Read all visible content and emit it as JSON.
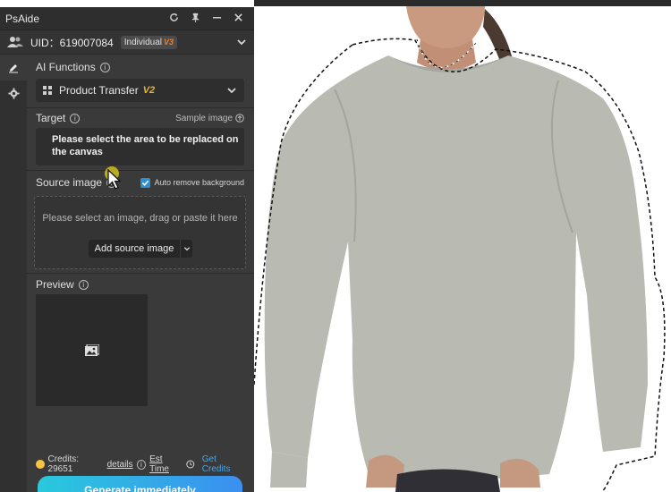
{
  "window": {
    "title": "PsAide",
    "controls": [
      "refresh-icon",
      "pin-icon",
      "minimize-icon",
      "close-icon"
    ]
  },
  "user": {
    "uid_label": "UID：619007084",
    "plan_label": "Individual",
    "plan_version": "V3"
  },
  "ai_functions": {
    "label": "AI Functions",
    "selected": "Product Transfer",
    "selected_version": "V2"
  },
  "target": {
    "label": "Target",
    "sample_link": "Sample image",
    "message": "Please select the area to be replaced on the canvas"
  },
  "source": {
    "label": "Source image",
    "auto_remove_label": "Auto remove background",
    "auto_remove_checked": true,
    "hint": "Please select an image, drag or paste it here",
    "add_button": "Add source image"
  },
  "preview": {
    "label": "Preview"
  },
  "footer": {
    "credits_label": "Credits: 29651",
    "details_link": "details",
    "est_time_link": "Est Time",
    "get_credits_link": "Get Credits"
  },
  "generate_button": "Generate immediately",
  "colors": {
    "panel_bg": "#3a3a3a",
    "accent_blue": "#2f8fd4",
    "plan_badge": "#e2853a",
    "version_badge": "#e2b43a",
    "link": "#4aa3e0",
    "shirt": "#b9bab1"
  }
}
